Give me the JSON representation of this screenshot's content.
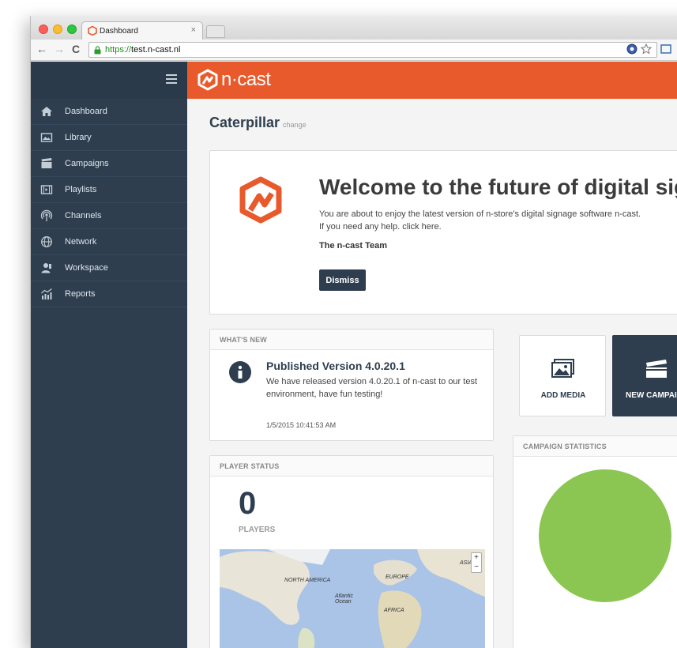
{
  "browser": {
    "tab_title": "Dashboard",
    "tab_close": "×",
    "url_scheme": "https://",
    "url_host": "test.n-cast.nl"
  },
  "app": {
    "logo_text": "n·cast",
    "brand_color": "#e85a2c",
    "sidebar_color": "#2e3e4f"
  },
  "sidebar": {
    "items": [
      {
        "label": "Dashboard",
        "icon": "home-icon"
      },
      {
        "label": "Library",
        "icon": "image-icon"
      },
      {
        "label": "Campaigns",
        "icon": "clapperboard-icon"
      },
      {
        "label": "Playlists",
        "icon": "film-strip-icon"
      },
      {
        "label": "Channels",
        "icon": "broadcast-icon"
      },
      {
        "label": "Network",
        "icon": "globe-icon"
      },
      {
        "label": "Workspace",
        "icon": "user-icon"
      },
      {
        "label": "Reports",
        "icon": "chart-icon"
      }
    ]
  },
  "page": {
    "title": "Caterpillar",
    "change_link": "change"
  },
  "welcome": {
    "title": "Welcome to the future of digital signage",
    "line1": "You are about to enjoy the latest version of n-store's digital signage software n-cast.",
    "line2": "If you need any help. click here.",
    "signature": "The n-cast Team",
    "dismiss_label": "Dismiss"
  },
  "whats_new": {
    "heading": "WHAT'S NEW",
    "title": "Published Version 4.0.20.1",
    "body": "We have released version 4.0.20.1 of n-cast to our test environment, have fun testing!",
    "date": "1/5/2015 10:41:53 AM"
  },
  "player_status": {
    "heading": "PLAYER STATUS",
    "count": "0",
    "label": "PLAYERS",
    "map_labels": {
      "north_america": "NORTH AMERICA",
      "europe": "EUROPE",
      "atlantic": "Atlantic Ocean",
      "africa": "AFRICA",
      "asia": "ASIA"
    },
    "zoom_in": "+",
    "zoom_out": "−"
  },
  "actions": {
    "add_media": "ADD MEDIA",
    "new_campaign": "NEW CAMPAIGN"
  },
  "campaign_stats": {
    "heading": "CAMPAIGN STATISTICS",
    "pie_color": "#8bc653"
  }
}
